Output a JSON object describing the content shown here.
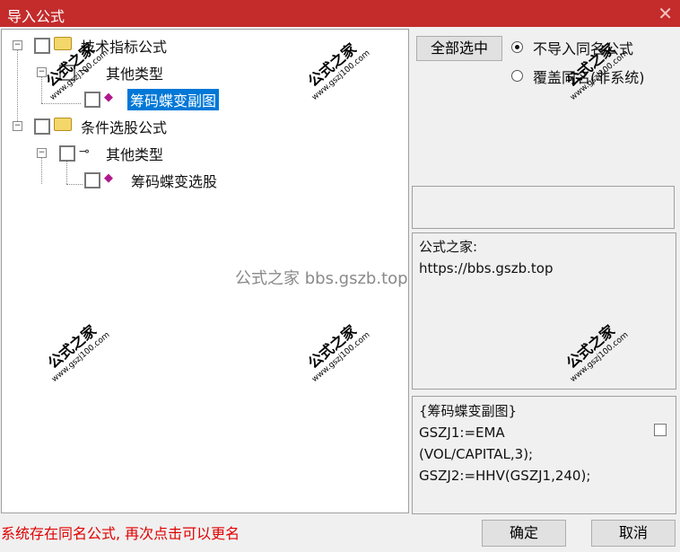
{
  "window": {
    "title": "导入公式",
    "close_glyph": "✕"
  },
  "tree": {
    "items": [
      {
        "label": "技术指标公式"
      },
      {
        "label": "其他类型"
      },
      {
        "label": "筹码蝶变副图"
      },
      {
        "label": "条件选股公式"
      },
      {
        "label": "其他类型"
      },
      {
        "label": "筹码蝶变选股"
      }
    ]
  },
  "options": {
    "select_all": "全部选中",
    "radio1": "不导入同名公式",
    "radio2": "覆盖同名(非系统)",
    "radio_selected": "radio1"
  },
  "info": {
    "site_label": "公式之家:",
    "url": "https://bbs.gszb.top"
  },
  "formula": {
    "lines": [
      "{筹码蝶变副图}",
      "GSZJ1:=EMA",
      "(VOL/CAPITAL,3);",
      "GSZJ2:=HHV(GSZJ1,240);"
    ]
  },
  "footer": {
    "status": "系统存在同名公式, 再次点击可以更名",
    "ok": "确定",
    "cancel": "取消"
  },
  "watermark": {
    "stamp": "公式之家",
    "site": "www.gszj100.com",
    "center": "公式之家 bbs.gszb.top"
  }
}
